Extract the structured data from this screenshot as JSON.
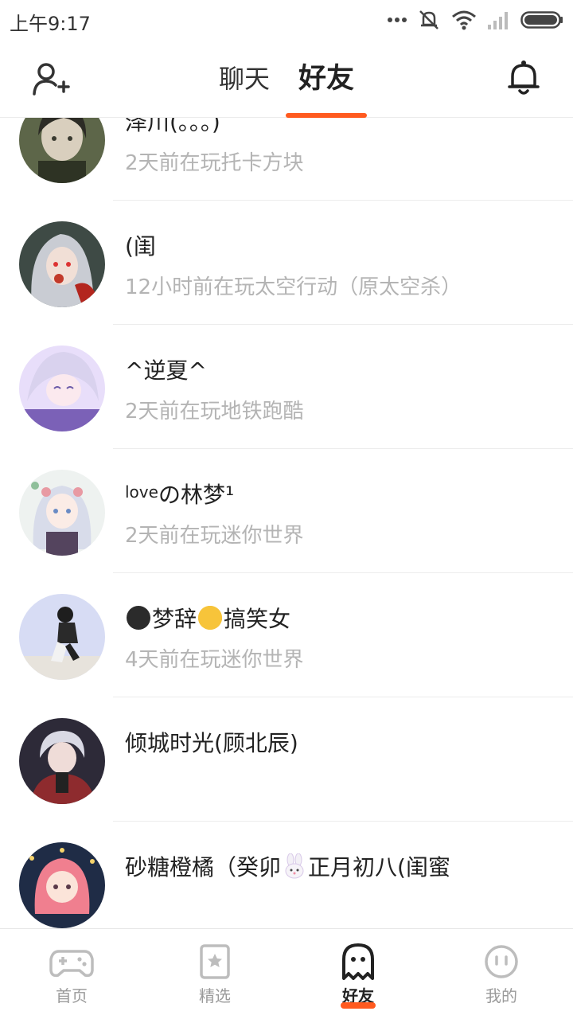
{
  "status_bar": {
    "time": "上午9:17"
  },
  "top_bar": {
    "tabs": [
      {
        "label": "聊天",
        "active": false
      },
      {
        "label": "好友",
        "active": true
      }
    ],
    "accent_color": "#ff5a1f"
  },
  "friends": [
    {
      "name": "泽川(。。。)",
      "status": "2天前在玩托卡方块"
    },
    {
      "name": "(闺",
      "status": "12小时前在玩太空行动（原太空杀）"
    },
    {
      "name": "^逆夏^",
      "status": "2天前在玩地铁跑酷"
    },
    {
      "name_small": "love",
      "name": "の林梦¹",
      "status": "2天前在玩迷你世界"
    },
    {
      "name_a": "梦辞",
      "name_b": "搞笑女",
      "status": "4天前在玩迷你世界"
    },
    {
      "name": "倾城时光(顾北辰)",
      "status": ""
    },
    {
      "name_a": "砂糖橙橘（癸卯",
      "name_b": "正月初八(闺蜜",
      "status": ""
    }
  ],
  "bottom_nav": [
    {
      "label": "首页",
      "icon": "gamepad-icon",
      "active": false
    },
    {
      "label": "精选",
      "icon": "star-card-icon",
      "active": false
    },
    {
      "label": "好友",
      "icon": "ghost-icon",
      "active": true
    },
    {
      "label": "我的",
      "icon": "face-icon",
      "active": false
    }
  ]
}
